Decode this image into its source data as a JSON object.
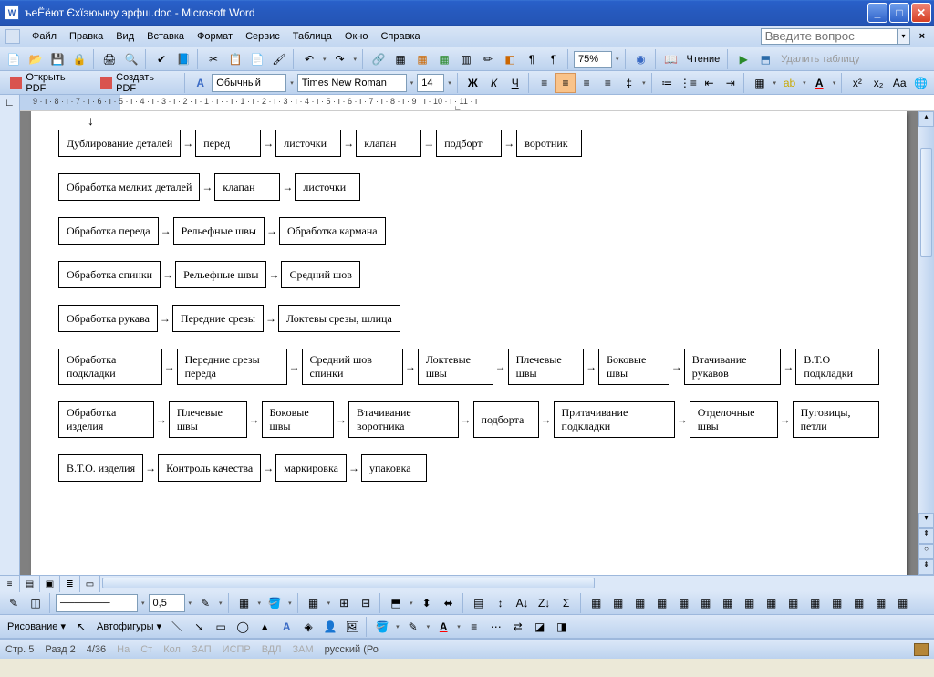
{
  "titlebar": {
    "title": "ъеЁёют Єхїэюыюу эрфш.doc - Microsoft Word"
  },
  "menubar": {
    "items": [
      "Файл",
      "Правка",
      "Вид",
      "Вставка",
      "Формат",
      "Сервис",
      "Таблица",
      "Окно",
      "Справка"
    ],
    "help_placeholder": "Введите вопрос"
  },
  "toolbar_main": {
    "zoom": "75%",
    "reading": "Чтение",
    "delete_table": "Удалить таблицу"
  },
  "toolbar_pdf": {
    "open_pdf": "Открыть PDF",
    "create_pdf": "Создать PDF"
  },
  "toolbar_fmt": {
    "style": "Обычный",
    "font": "Times New Roman",
    "size": "14"
  },
  "ruler": {
    "numbers": "9 · ı · 8 · ı · 7 · ı · 6 · ı · 5 · ı · 4 · ı · 3 · ı · 2 · ı · 1 · ı ·    · ı · 1 · ı · 2 · ı · 3 · ı · 4 · ı · 5 · ı · 6 · ı · 7 · ı · 8 · ı · 9 · ı · 10 · ı · 11 · ı"
  },
  "flowchart": {
    "rows": [
      [
        "Дублирование деталей",
        "перед",
        "листочки",
        "клапан",
        "подборт",
        "воротник"
      ],
      [
        "Обработка мелких деталей",
        "клапан",
        "листочки"
      ],
      [
        "Обработка переда",
        "Рельефные швы",
        "Обработка кармана"
      ],
      [
        "Обработка спинки",
        "Рельефные швы",
        "Средний шов"
      ],
      [
        "Обработка рукава",
        "Передние срезы",
        "Локтевы срезы, шлица"
      ],
      [
        "Обработка подкладки",
        "Передние срезы переда",
        "Средний шов спинки",
        "Локтевые швы",
        "Плечевые швы",
        "Боковые швы",
        "Втачивание рукавов",
        "В.Т.О подкладки"
      ],
      [
        "Обработка изделия",
        "Плечевые швы",
        "Боковые швы",
        "Втачивание воротника",
        "подборта",
        "Притачивание подкладки",
        "Отделочные швы",
        "Пуговицы, петли"
      ],
      [
        "В.Т.О. изделия",
        "Контроль качества",
        "маркировка",
        "упаковка"
      ]
    ]
  },
  "drawing_toolbar": {
    "label": "Рисование",
    "autoshapes": "Автофигуры",
    "stroke": "0,5"
  },
  "statusbar": {
    "page": "Стр. 5",
    "section": "Разд 2",
    "pages": "4/36",
    "at": "На",
    "line": "Ст",
    "col": "Кол",
    "rec": "ЗАП",
    "trk": "ИСПР",
    "ext": "ВДЛ",
    "ovr": "ЗАМ",
    "lang": "русский (Ро"
  }
}
